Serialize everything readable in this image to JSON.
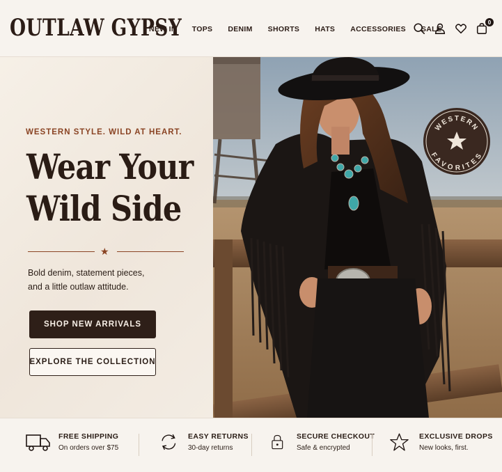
{
  "header": {
    "logo": "OUTLAW GYPSY",
    "nav": [
      "NEW IN",
      "TOPS",
      "DENIM",
      "SHORTS",
      "HATS",
      "ACCESSORIES",
      "SALE"
    ],
    "icons": [
      "search-icon",
      "account-icon",
      "heart-icon",
      "bag-icon"
    ],
    "cart_count": "0"
  },
  "hero": {
    "eyebrow": "WESTERN STYLE. WILD AT HEART.",
    "headline_line1": "Wear Your",
    "headline_line2": "Wild Side",
    "subtext_line1": "Bold denim, statement pieces,",
    "subtext_line2": "and a little outlaw attitude.",
    "primary_button": "SHOP NEW ARRIVALS",
    "secondary_button": "EXPLORE THE COLLECTION"
  },
  "badge": {
    "top_text": "WESTERN",
    "bottom_text": "FAVORITES"
  },
  "features": [
    {
      "icon": "truck-icon",
      "title": "FREE SHIPPING",
      "subtitle": "On orders over $75"
    },
    {
      "icon": "returns-icon",
      "title": "EASY RETURNS",
      "subtitle": "30-day returns"
    },
    {
      "icon": "lock-icon",
      "title": "SECURE CHECKOUT",
      "subtitle": "Safe & encrypted"
    },
    {
      "icon": "star-icon",
      "title": "EXCLUSIVE DROPS",
      "subtitle": "New looks, first."
    }
  ],
  "colors": {
    "brand_dark": "#2e1f18",
    "accent_rust": "#8a4424",
    "background": "#f6f1ea"
  }
}
